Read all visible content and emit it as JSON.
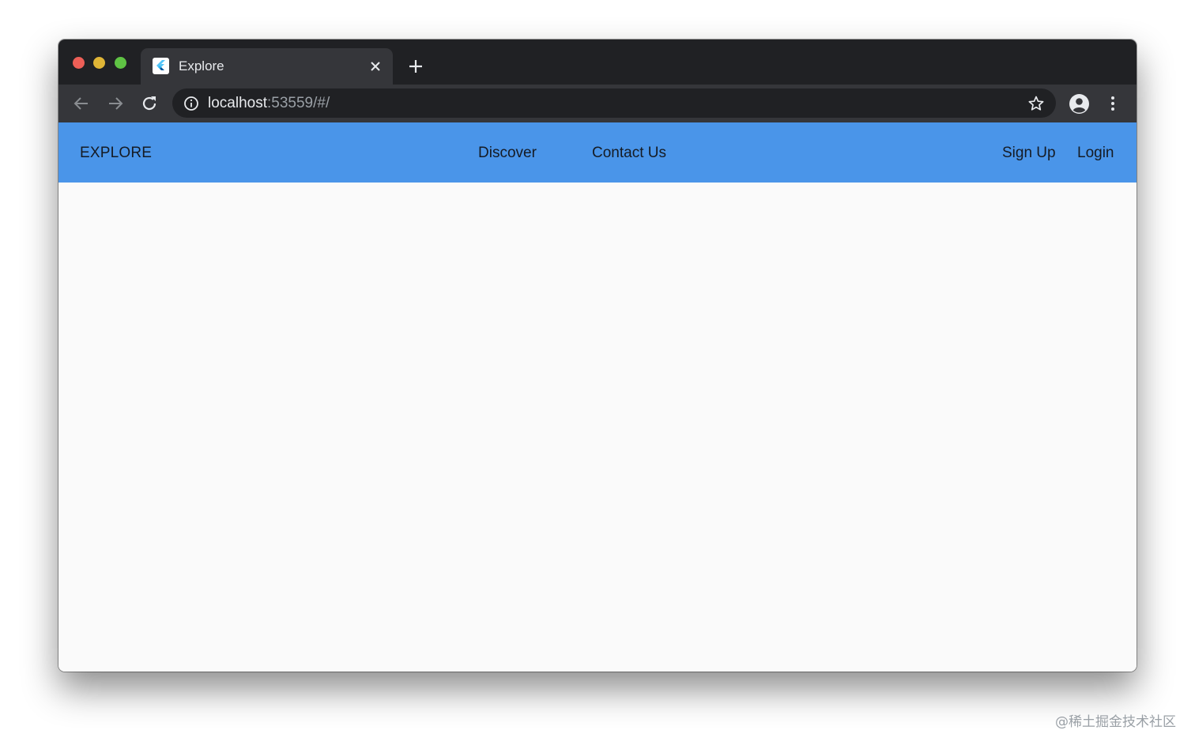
{
  "browser": {
    "tab": {
      "title": "Explore",
      "favicon": "flutter-logo-icon"
    },
    "address_bar": {
      "host": "localhost",
      "rest": ":53559/#/"
    },
    "icons": {
      "back": "back-arrow-icon",
      "forward": "forward-arrow-icon",
      "reload": "reload-icon",
      "info": "info-icon",
      "bookmark": "star-icon",
      "profile": "account-circle-icon",
      "menu": "more-vert-icon",
      "new_tab": "plus-icon",
      "close_tab": "close-icon"
    }
  },
  "app": {
    "brand": "EXPLORE",
    "nav": {
      "discover": "Discover",
      "contact": "Contact Us",
      "signup": "Sign Up",
      "login": "Login"
    },
    "colors": {
      "appbar": "#4a95e9",
      "background": "#fafafa"
    }
  },
  "watermark": "@稀土掘金技术社区"
}
